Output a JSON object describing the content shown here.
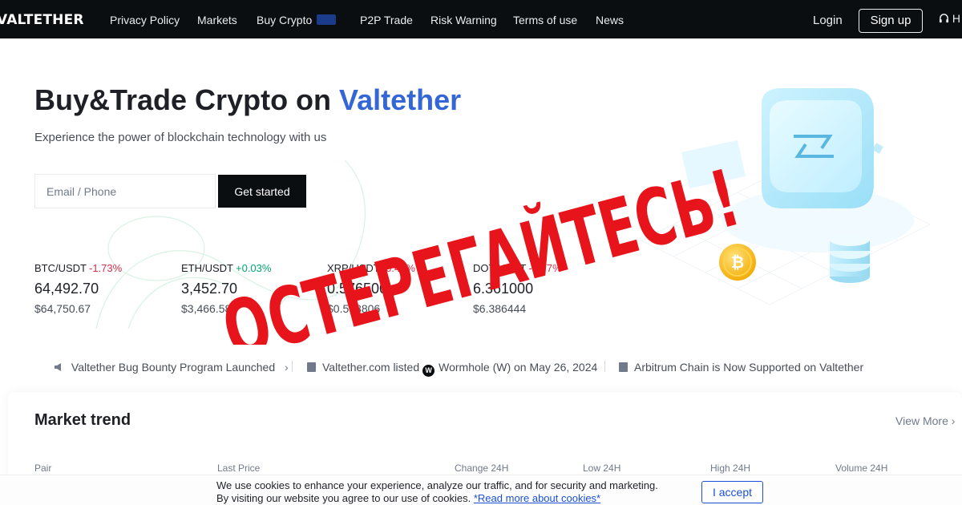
{
  "nav": {
    "logo": "VALTETHER",
    "items": [
      "Privacy Policy",
      "Markets",
      "Buy Crypto",
      "P2P Trade",
      "Risk Warning",
      "Terms of use",
      "News"
    ],
    "login": "Login",
    "signup": "Sign up",
    "help_fragment": "H"
  },
  "hero": {
    "title_prefix": "Buy&Trade Crypto on ",
    "title_brand": "Valtether",
    "subtitle": "Experience the power of blockchain technology with us",
    "email_placeholder": "Email / Phone",
    "cta": "Get started"
  },
  "tickers": [
    {
      "pair": "BTC/USDT",
      "change": "-1.73%",
      "price": "64,492.70",
      "usd": "$64,750.67",
      "direction": "down"
    },
    {
      "pair": "ETH/USDT",
      "change": "+0.03%",
      "price": "3,452.70",
      "usd": "$3,466.58",
      "direction": "up"
    },
    {
      "pair": "XRP/USDT",
      "change": "-0.41%",
      "price": "0.576500",
      "usd": "$0.578806",
      "direction": "down"
    },
    {
      "pair": "DOT/USDT",
      "change": "-2.77%",
      "price": "6.361000",
      "usd": "$6.386444",
      "direction": "down"
    }
  ],
  "announcements": {
    "item1": "Valtether Bug Bounty Program Launched",
    "item2_prefix": "Valtether.com listed",
    "item2_token": "Wormhole (W) on May 26, 2024",
    "item3": "Arbitrum Chain is Now Supported on Valtether"
  },
  "market": {
    "title": "Market trend",
    "view_more": "View More",
    "columns": [
      "Pair",
      "Last Price",
      "Change 24H",
      "Low 24H",
      "High 24H",
      "Volume 24H"
    ]
  },
  "cookie": {
    "line1": "We use cookies to enhance your experience, analyze our traffic, and for security and marketing.",
    "line2": "By visiting our website you agree to our use of cookies.",
    "link": "*Read more about cookies*",
    "accept": "I accept"
  },
  "overlay": {
    "warning": "ОСТЕРЕГАЙТЕСЬ!"
  },
  "colors": {
    "brand_blue": "#3566d6",
    "nav_bg": "#0b0e11",
    "negative": "#cf304a",
    "positive": "#03a66d",
    "warning_red": "#e8141c"
  }
}
